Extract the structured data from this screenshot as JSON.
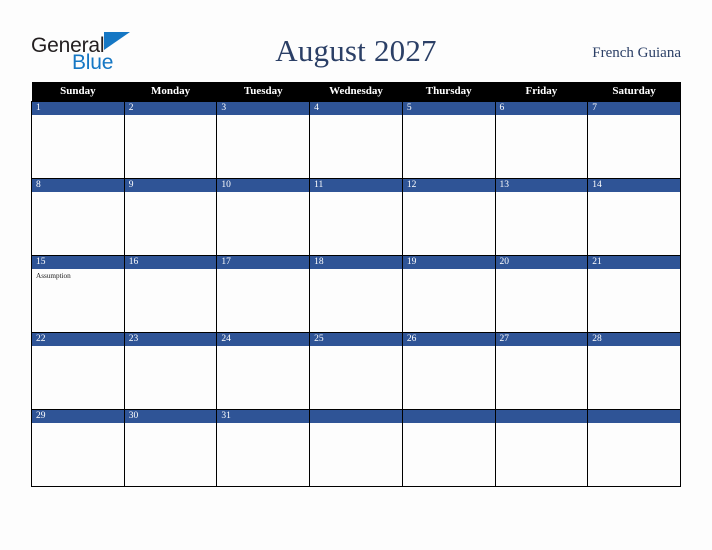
{
  "branding": {
    "logo_line1": "General",
    "logo_line2": "Blue",
    "logo_triangle_icon": "triangle-icon",
    "logo_dark_color": "#231f20",
    "logo_blue_color": "#1577c4"
  },
  "header": {
    "title": "August 2027",
    "month": "August",
    "year": "2027",
    "region": "French Guiana",
    "title_color": "#2b3f66"
  },
  "theme": {
    "daybar_blue": "#2f5496",
    "header_black": "#000000",
    "cell_background": "#fdfdfd",
    "page_background": "#fdfdfd",
    "grid_line": "#000000"
  },
  "calendar": {
    "weekday_headers": [
      "Sunday",
      "Monday",
      "Tuesday",
      "Wednesday",
      "Thursday",
      "Friday",
      "Saturday"
    ],
    "weeks": [
      [
        {
          "day": "1",
          "events": []
        },
        {
          "day": "2",
          "events": []
        },
        {
          "day": "3",
          "events": []
        },
        {
          "day": "4",
          "events": []
        },
        {
          "day": "5",
          "events": []
        },
        {
          "day": "6",
          "events": []
        },
        {
          "day": "7",
          "events": []
        }
      ],
      [
        {
          "day": "8",
          "events": []
        },
        {
          "day": "9",
          "events": []
        },
        {
          "day": "10",
          "events": []
        },
        {
          "day": "11",
          "events": []
        },
        {
          "day": "12",
          "events": []
        },
        {
          "day": "13",
          "events": []
        },
        {
          "day": "14",
          "events": []
        }
      ],
      [
        {
          "day": "15",
          "events": [
            "Assumption"
          ]
        },
        {
          "day": "16",
          "events": []
        },
        {
          "day": "17",
          "events": []
        },
        {
          "day": "18",
          "events": []
        },
        {
          "day": "19",
          "events": []
        },
        {
          "day": "20",
          "events": []
        },
        {
          "day": "21",
          "events": []
        }
      ],
      [
        {
          "day": "22",
          "events": []
        },
        {
          "day": "23",
          "events": []
        },
        {
          "day": "24",
          "events": []
        },
        {
          "day": "25",
          "events": []
        },
        {
          "day": "26",
          "events": []
        },
        {
          "day": "27",
          "events": []
        },
        {
          "day": "28",
          "events": []
        }
      ],
      [
        {
          "day": "29",
          "events": []
        },
        {
          "day": "30",
          "events": []
        },
        {
          "day": "31",
          "events": []
        },
        {
          "day": "",
          "events": []
        },
        {
          "day": "",
          "events": []
        },
        {
          "day": "",
          "events": []
        },
        {
          "day": "",
          "events": []
        }
      ]
    ]
  }
}
